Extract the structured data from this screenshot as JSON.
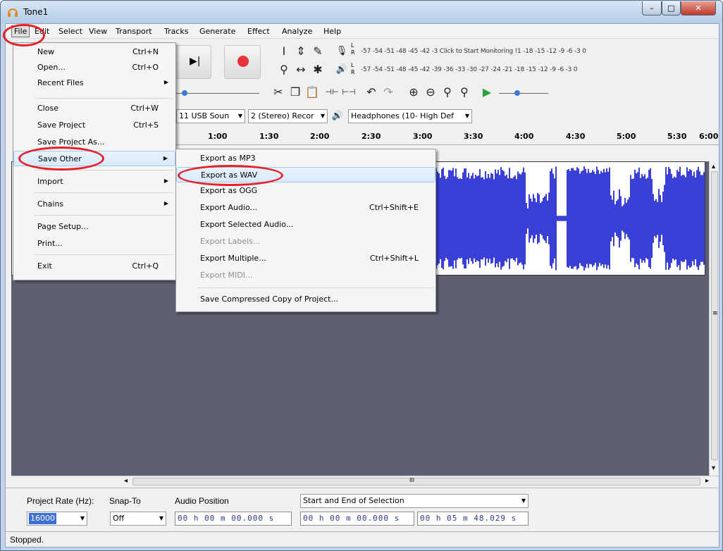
{
  "window": {
    "title": "Tone1",
    "min": "–",
    "max": "□",
    "close": "✕"
  },
  "menubar": [
    "File",
    "Edit",
    "Select",
    "View",
    "Transport",
    "Tracks",
    "Generate",
    "Effect",
    "Analyze",
    "Help"
  ],
  "file_menu": [
    {
      "label": "New",
      "shortcut": "Ctrl+N"
    },
    {
      "label": "Open...",
      "shortcut": "Ctrl+O"
    },
    {
      "label": "Recent Files",
      "submenu": true
    },
    {
      "label": "Close",
      "shortcut": "Ctrl+W"
    },
    {
      "label": "Save Project",
      "shortcut": "Ctrl+S"
    },
    {
      "label": "Save Project As..."
    },
    {
      "label": "Save Other",
      "submenu": true
    },
    {
      "label": "Import",
      "submenu": true
    },
    {
      "label": "Chains",
      "submenu": true
    },
    {
      "label": "Page Setup..."
    },
    {
      "label": "Print..."
    },
    {
      "label": "Exit",
      "shortcut": "Ctrl+Q"
    }
  ],
  "save_other_menu": [
    {
      "label": "Export as MP3"
    },
    {
      "label": "Export as WAV"
    },
    {
      "label": "Export as OGG"
    },
    {
      "label": "Export Audio...",
      "shortcut": "Ctrl+Shift+E"
    },
    {
      "label": "Export Selected Audio..."
    },
    {
      "label": "Export Labels...",
      "disabled": true
    },
    {
      "label": "Export Multiple...",
      "shortcut": "Ctrl+Shift+L"
    },
    {
      "label": "Export MIDI...",
      "disabled": true
    },
    {
      "label": "Save Compressed Copy of Project..."
    }
  ],
  "meters": {
    "record": "-57 -54 -51 -48 -45 -42 -3 Click to Start Monitoring !1 -18 -15 -12 -9 -6 -3 0",
    "playback": "-57 -54 -51 -48 -45 -42 -39 -36 -33 -30 -27 -24 -21 -18 -15 -12 -9 -6 -3 0",
    "L": "L",
    "R": "R"
  },
  "devices": {
    "input": "11 USB Soun",
    "channels": "2 (Stereo) Recor",
    "output": "Headphones (10- High Def"
  },
  "ruler": [
    "1:00",
    "1:30",
    "2:00",
    "2:30",
    "3:00",
    "3:30",
    "4:00",
    "4:30",
    "5:00",
    "5:30",
    "6:00"
  ],
  "selection_toolbar": {
    "rate_label": "Project Rate (Hz):",
    "rate_value": "16000",
    "snap_label": "Snap-To",
    "snap_value": "Off",
    "audio_position_label": "Audio Position",
    "audio_position": "00 h 00 m 00.000 s",
    "selection_mode": "Start and End of Selection",
    "sel_start": "00 h 00 m 00.000 s",
    "sel_end": "00 h 05 m 48.029 s"
  },
  "status": "Stopped.",
  "scroll": {
    "left": "◂",
    "right": "▸",
    "up": "▴",
    "down": "▾",
    "grip": "III",
    "vgrip": "≡"
  },
  "colors": {
    "waveform": "#3a3fd6",
    "highlight_ring": "#e5202b",
    "track_bg": "#5d6071"
  }
}
